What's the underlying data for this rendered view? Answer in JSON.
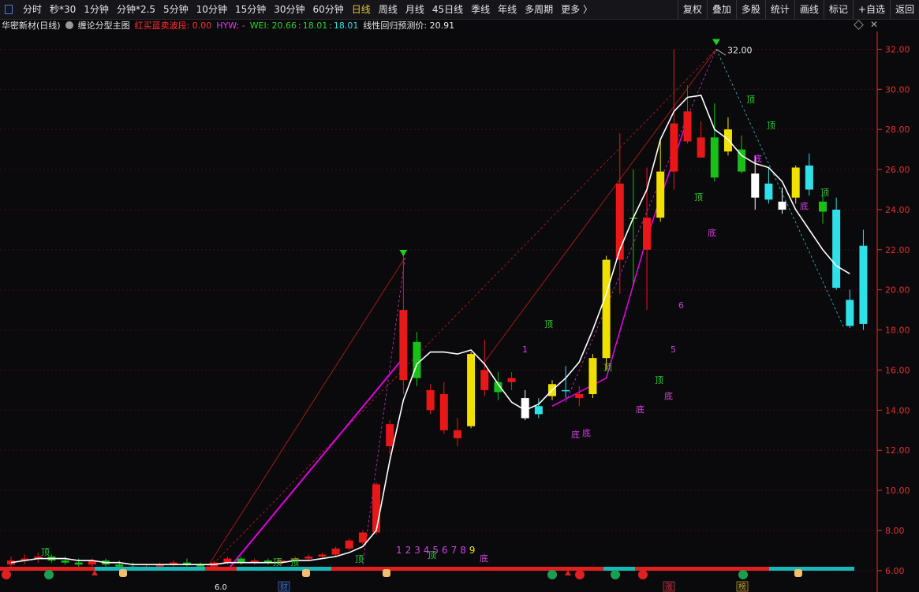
{
  "toolbar": {
    "periods": [
      "分时",
      "秒*30",
      "1分钟",
      "分钟*2.5",
      "5分钟",
      "10分钟",
      "15分钟",
      "30分钟",
      "60分钟",
      "日线",
      "周线",
      "月线",
      "45日线",
      "季线",
      "年线",
      "多周期",
      "更多 〉"
    ],
    "active_period": "日线",
    "right_tools": [
      "复权",
      "叠加",
      "多股",
      "统计",
      "画线",
      "标记",
      "+自选",
      "返回"
    ]
  },
  "indicator": {
    "stock_name": "华密新材(日线)",
    "indicator_name": "缠论分型主图",
    "hongmai": "红买蓝卖波段: 0.00",
    "hyw": "HYW: -",
    "wei_label": "WEI:",
    "wei_v1": "20.66",
    "wei_v2": "18.01",
    "wei_v3": "18.01",
    "forecast": "线性回归预测价: 20.91"
  },
  "colors": {
    "up": "#e81818",
    "down": "#18c018",
    "yellow": "#f0e000",
    "cyan": "#30e0e8",
    "white": "#ffffff",
    "ma": "#ffffff",
    "trend": "#e000e0",
    "axis": "#e03030",
    "grid": "#3a1010"
  },
  "chart_data": {
    "type": "candlestick",
    "ylim": [
      5.6,
      33.0
    ],
    "yticks": [
      "32.00",
      "30.00",
      "28.00",
      "26.00",
      "24.00",
      "22.00",
      "20.00",
      "18.00",
      "16.00",
      "14.00",
      "12.00",
      "10.00",
      "8.00",
      "6.00"
    ],
    "high_label": "32.00",
    "low_label": "6.0",
    "candles": [
      {
        "o": 6.3,
        "h": 6.7,
        "l": 6.1,
        "c": 6.5,
        "k": "up"
      },
      {
        "o": 6.5,
        "h": 6.8,
        "l": 6.3,
        "c": 6.6,
        "k": "up"
      },
      {
        "o": 6.6,
        "h": 6.9,
        "l": 6.4,
        "c": 6.7,
        "k": "up"
      },
      {
        "o": 6.7,
        "h": 6.8,
        "l": 6.4,
        "c": 6.5,
        "k": "down"
      },
      {
        "o": 6.5,
        "h": 6.7,
        "l": 6.3,
        "c": 6.4,
        "k": "down"
      },
      {
        "o": 6.4,
        "h": 6.6,
        "l": 6.2,
        "c": 6.3,
        "k": "down"
      },
      {
        "o": 6.3,
        "h": 6.6,
        "l": 6.2,
        "c": 6.5,
        "k": "up"
      },
      {
        "o": 6.5,
        "h": 6.6,
        "l": 6.2,
        "c": 6.3,
        "k": "down"
      },
      {
        "o": 6.3,
        "h": 6.5,
        "l": 6.1,
        "c": 6.2,
        "k": "down"
      },
      {
        "o": 6.2,
        "h": 6.4,
        "l": 6.0,
        "c": 6.1,
        "k": "down"
      },
      {
        "o": 6.1,
        "h": 6.3,
        "l": 6.0,
        "c": 6.2,
        "k": "up"
      },
      {
        "o": 6.2,
        "h": 6.4,
        "l": 6.1,
        "c": 6.3,
        "k": "up"
      },
      {
        "o": 6.3,
        "h": 6.5,
        "l": 6.2,
        "c": 6.4,
        "k": "up"
      },
      {
        "o": 6.4,
        "h": 6.6,
        "l": 6.2,
        "c": 6.3,
        "k": "down"
      },
      {
        "o": 6.3,
        "h": 6.4,
        "l": 6.1,
        "c": 6.2,
        "k": "down"
      },
      {
        "o": 6.2,
        "h": 6.5,
        "l": 6.1,
        "c": 6.4,
        "k": "up"
      },
      {
        "o": 6.4,
        "h": 6.7,
        "l": 6.3,
        "c": 6.6,
        "k": "up"
      },
      {
        "o": 6.6,
        "h": 6.7,
        "l": 6.3,
        "c": 6.4,
        "k": "down"
      },
      {
        "o": 6.4,
        "h": 6.6,
        "l": 6.3,
        "c": 6.5,
        "k": "up"
      },
      {
        "o": 6.5,
        "h": 6.6,
        "l": 6.3,
        "c": 6.4,
        "k": "down"
      },
      {
        "o": 6.4,
        "h": 6.6,
        "l": 6.3,
        "c": 6.5,
        "k": "up"
      },
      {
        "o": 6.5,
        "h": 6.7,
        "l": 6.4,
        "c": 6.6,
        "k": "up"
      },
      {
        "o": 6.6,
        "h": 6.8,
        "l": 6.5,
        "c": 6.7,
        "k": "up"
      },
      {
        "o": 6.7,
        "h": 6.9,
        "l": 6.6,
        "c": 6.8,
        "k": "up"
      },
      {
        "o": 6.8,
        "h": 7.2,
        "l": 6.7,
        "c": 7.1,
        "k": "up"
      },
      {
        "o": 7.1,
        "h": 7.6,
        "l": 7.0,
        "c": 7.5,
        "k": "up"
      },
      {
        "o": 7.4,
        "h": 8.0,
        "l": 7.3,
        "c": 7.9,
        "k": "up"
      },
      {
        "o": 7.9,
        "h": 10.4,
        "l": 7.8,
        "c": 10.3,
        "k": "up"
      },
      {
        "o": 12.2,
        "h": 13.5,
        "l": 11.8,
        "c": 13.3,
        "k": "up"
      },
      {
        "o": 15.5,
        "h": 21.7,
        "l": 14.8,
        "c": 19.0,
        "k": "up"
      },
      {
        "o": 17.4,
        "h": 17.9,
        "l": 15.2,
        "c": 15.6,
        "k": "down"
      },
      {
        "o": 15.0,
        "h": 15.3,
        "l": 13.8,
        "c": 14.0,
        "k": "up"
      },
      {
        "o": 14.8,
        "h": 15.4,
        "l": 12.8,
        "c": 13.0,
        "k": "up"
      },
      {
        "o": 13.0,
        "h": 13.6,
        "l": 12.2,
        "c": 12.6,
        "k": "up"
      },
      {
        "o": 13.2,
        "h": 16.9,
        "l": 13.1,
        "c": 16.8,
        "k": "yellow"
      },
      {
        "o": 16.0,
        "h": 17.5,
        "l": 14.7,
        "c": 15.0,
        "k": "up"
      },
      {
        "o": 14.9,
        "h": 15.9,
        "l": 14.5,
        "c": 15.4,
        "k": "down"
      },
      {
        "o": 15.4,
        "h": 15.9,
        "l": 15.0,
        "c": 15.6,
        "k": "up"
      },
      {
        "o": 14.6,
        "h": 15.0,
        "l": 13.5,
        "c": 13.6,
        "k": "white"
      },
      {
        "o": 14.2,
        "h": 14.6,
        "l": 13.6,
        "c": 13.8,
        "k": "cyan"
      },
      {
        "o": 14.7,
        "h": 15.5,
        "l": 14.5,
        "c": 15.3,
        "k": "yellow"
      },
      {
        "o": 15.0,
        "h": 16.2,
        "l": 14.6,
        "c": 15.0,
        "k": "cyan"
      },
      {
        "o": 14.6,
        "h": 15.2,
        "l": 14.2,
        "c": 14.8,
        "k": "up"
      },
      {
        "o": 14.8,
        "h": 16.8,
        "l": 14.6,
        "c": 16.6,
        "k": "yellow"
      },
      {
        "o": 16.6,
        "h": 21.7,
        "l": 16.0,
        "c": 21.5,
        "k": "yellow"
      },
      {
        "o": 21.5,
        "h": 27.8,
        "l": 19.8,
        "c": 25.3,
        "k": "up"
      },
      {
        "o": 23.6,
        "h": 26.0,
        "l": 20.2,
        "c": 23.6,
        "k": "down"
      },
      {
        "o": 23.6,
        "h": 26.1,
        "l": 19.0,
        "c": 22.0,
        "k": "up"
      },
      {
        "o": 23.6,
        "h": 27.5,
        "l": 23.4,
        "c": 25.9,
        "k": "yellow"
      },
      {
        "o": 25.9,
        "h": 32.0,
        "l": 25.0,
        "c": 28.3,
        "k": "up"
      },
      {
        "o": 28.9,
        "h": 30.2,
        "l": 27.3,
        "c": 27.4,
        "k": "up"
      },
      {
        "o": 27.6,
        "h": 28.4,
        "l": 26.6,
        "c": 26.6,
        "k": "up"
      },
      {
        "o": 27.6,
        "h": 29.3,
        "l": 25.4,
        "c": 25.6,
        "k": "down"
      },
      {
        "o": 26.9,
        "h": 28.6,
        "l": 26.7,
        "c": 28.0,
        "k": "yellow"
      },
      {
        "o": 27.0,
        "h": 27.7,
        "l": 25.8,
        "c": 25.9,
        "k": "down"
      },
      {
        "o": 25.8,
        "h": 26.7,
        "l": 24.0,
        "c": 24.6,
        "k": "white"
      },
      {
        "o": 25.3,
        "h": 26.1,
        "l": 24.3,
        "c": 24.5,
        "k": "cyan"
      },
      {
        "o": 24.4,
        "h": 25.1,
        "l": 23.8,
        "c": 24.0,
        "k": "white"
      },
      {
        "o": 24.6,
        "h": 26.2,
        "l": 24.3,
        "c": 26.1,
        "k": "yellow"
      },
      {
        "o": 26.2,
        "h": 26.8,
        "l": 24.7,
        "c": 25.0,
        "k": "cyan"
      },
      {
        "o": 24.4,
        "h": 24.9,
        "l": 23.3,
        "c": 23.9,
        "k": "down"
      },
      {
        "o": 24.0,
        "h": 24.6,
        "l": 20.0,
        "c": 20.1,
        "k": "cyan"
      },
      {
        "o": 19.5,
        "h": 20.0,
        "l": 18.1,
        "c": 18.2,
        "k": "cyan"
      },
      {
        "o": 18.3,
        "h": 23.0,
        "l": 18.0,
        "c": 22.2,
        "k": "cyan"
      }
    ],
    "ma": [
      6.4,
      6.5,
      6.6,
      6.6,
      6.6,
      6.5,
      6.5,
      6.4,
      6.4,
      6.3,
      6.3,
      6.3,
      6.3,
      6.3,
      6.3,
      6.3,
      6.4,
      6.4,
      6.4,
      6.4,
      6.4,
      6.5,
      6.5,
      6.6,
      6.7,
      6.9,
      7.2,
      8.0,
      11.5,
      14.5,
      16.3,
      16.9,
      16.9,
      16.8,
      17.0,
      16.3,
      15.3,
      14.4,
      14.0,
      14.3,
      15.0,
      15.6,
      16.4,
      18.0,
      19.8,
      22.0,
      23.6,
      25.0,
      27.5,
      28.9,
      29.6,
      29.7,
      28.0,
      27.5,
      26.7,
      26.3,
      26.1,
      25.4,
      24.0,
      23.0,
      22.0,
      21.2,
      20.8
    ],
    "tops": [
      "顶",
      "顶",
      "顶",
      "顶",
      "顶",
      "顶",
      "顶",
      "顶",
      "顶",
      "顶",
      "顶",
      "顶"
    ],
    "bottoms": [
      "底",
      "底",
      "底",
      "底",
      "底",
      "底",
      "底",
      "底"
    ],
    "count_labels": [
      "1",
      "2",
      "3",
      "4",
      "5",
      "6",
      "7",
      "8",
      "9"
    ],
    "signals": [
      "财",
      "涨",
      "榜"
    ]
  }
}
